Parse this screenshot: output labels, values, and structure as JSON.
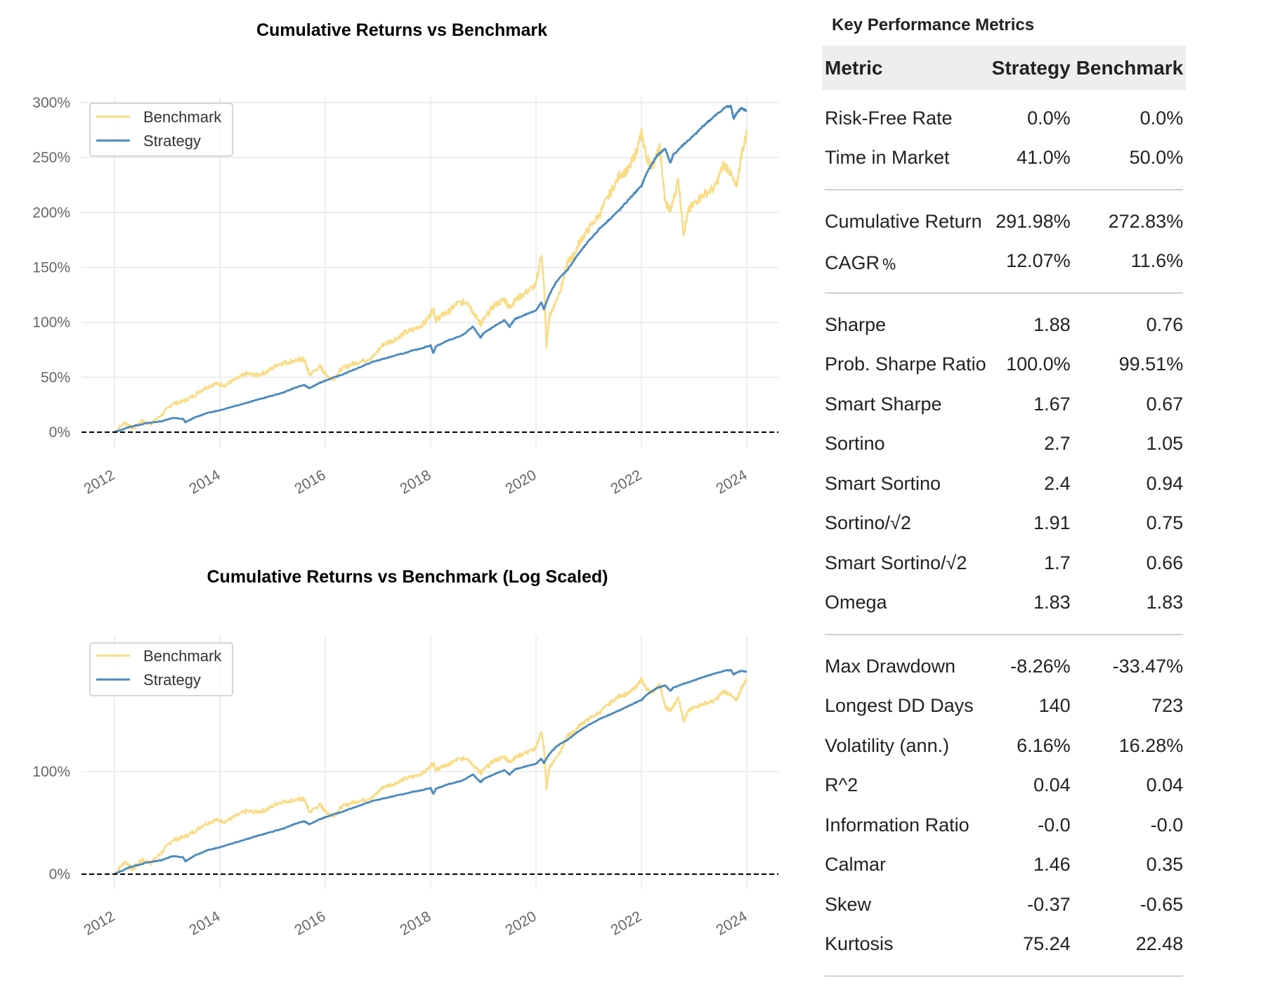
{
  "colors": {
    "benchmark": "#f9dc86",
    "strategy": "#4a89bf",
    "grid": "#e5e5e5",
    "zero_line": "#000000",
    "header_bg": "#eeeeee"
  },
  "chart_data": [
    {
      "type": "line",
      "title": "Cumulative Returns vs Benchmark",
      "xlabel": "",
      "ylabel": "",
      "yscale": "linear",
      "xlim": [
        2011.6,
        2024.6
      ],
      "ylim": [
        -0.1,
        3.0
      ],
      "x_ticks": [
        "2012",
        "2014",
        "2016",
        "2018",
        "2020",
        "2022",
        "2024"
      ],
      "x_tick_values": [
        2012,
        2014,
        2016,
        2018,
        2020,
        2022,
        2024
      ],
      "y_ticks": [
        "0%",
        "50%",
        "100%",
        "150%",
        "200%",
        "250%",
        "300%"
      ],
      "y_tick_values": [
        0,
        0.5,
        1.0,
        1.5,
        2.0,
        2.5,
        3.0
      ],
      "grid": true,
      "legend": "top-left",
      "reference_line": {
        "y": 0,
        "style": "dashed"
      },
      "series": [
        {
          "name": "Benchmark",
          "x": [
            2012.0,
            2012.2,
            2012.35,
            2012.5,
            2012.7,
            2012.9,
            2013.1,
            2013.3,
            2013.5,
            2013.7,
            2013.9,
            2014.1,
            2014.3,
            2014.5,
            2014.7,
            2014.9,
            2015.1,
            2015.3,
            2015.5,
            2015.6,
            2015.7,
            2015.9,
            2016.0,
            2016.15,
            2016.3,
            2016.5,
            2016.7,
            2016.9,
            2017.1,
            2017.3,
            2017.5,
            2017.7,
            2017.9,
            2018.05,
            2018.1,
            2018.2,
            2018.35,
            2018.5,
            2018.7,
            2018.8,
            2018.95,
            2019.0,
            2019.2,
            2019.4,
            2019.5,
            2019.6,
            2019.8,
            2020.0,
            2020.1,
            2020.15,
            2020.2,
            2020.25,
            2020.35,
            2020.5,
            2020.6,
            2020.7,
            2020.85,
            2021.0,
            2021.2,
            2021.4,
            2021.6,
            2021.75,
            2021.9,
            2022.0,
            2022.1,
            2022.2,
            2022.35,
            2022.45,
            2022.55,
            2022.7,
            2022.8,
            2022.9,
            2023.05,
            2023.2,
            2023.4,
            2023.55,
            2023.65,
            2023.8,
            2023.9,
            2024.0
          ],
          "y": [
            0.0,
            0.09,
            0.03,
            0.1,
            0.08,
            0.16,
            0.26,
            0.28,
            0.33,
            0.4,
            0.44,
            0.43,
            0.48,
            0.53,
            0.52,
            0.55,
            0.62,
            0.64,
            0.66,
            0.66,
            0.52,
            0.6,
            0.53,
            0.48,
            0.57,
            0.62,
            0.65,
            0.68,
            0.8,
            0.84,
            0.9,
            0.94,
            1.0,
            1.12,
            1.02,
            1.06,
            1.1,
            1.17,
            1.19,
            1.1,
            0.98,
            1.02,
            1.15,
            1.21,
            1.13,
            1.2,
            1.27,
            1.34,
            1.63,
            1.35,
            0.77,
            1.05,
            1.16,
            1.35,
            1.55,
            1.6,
            1.75,
            1.85,
            1.98,
            2.17,
            2.35,
            2.38,
            2.55,
            2.72,
            2.5,
            2.42,
            2.58,
            2.1,
            2.01,
            2.3,
            1.82,
            2.02,
            2.11,
            2.17,
            2.23,
            2.43,
            2.4,
            2.22,
            2.53,
            2.72
          ]
        },
        {
          "name": "Strategy",
          "x": [
            2012.0,
            2012.3,
            2012.6,
            2012.9,
            2013.1,
            2013.3,
            2013.35,
            2013.5,
            2013.8,
            2014.0,
            2014.3,
            2014.6,
            2014.9,
            2015.2,
            2015.4,
            2015.6,
            2015.7,
            2015.9,
            2016.0,
            2016.3,
            2016.6,
            2016.9,
            2017.2,
            2017.5,
            2017.8,
            2018.0,
            2018.05,
            2018.1,
            2018.3,
            2018.6,
            2018.8,
            2018.95,
            2019.0,
            2019.2,
            2019.4,
            2019.5,
            2019.6,
            2019.8,
            2020.0,
            2020.1,
            2020.15,
            2020.25,
            2020.4,
            2020.6,
            2020.8,
            2021.0,
            2021.2,
            2021.4,
            2021.6,
            2021.8,
            2022.0,
            2022.1,
            2022.3,
            2022.45,
            2022.55,
            2022.6,
            2022.8,
            2023.0,
            2023.2,
            2023.4,
            2023.6,
            2023.7,
            2023.75,
            2023.8,
            2023.9,
            2024.0
          ],
          "y": [
            0.0,
            0.05,
            0.08,
            0.1,
            0.13,
            0.12,
            0.09,
            0.13,
            0.18,
            0.2,
            0.24,
            0.28,
            0.32,
            0.36,
            0.4,
            0.43,
            0.4,
            0.45,
            0.47,
            0.52,
            0.58,
            0.64,
            0.68,
            0.72,
            0.76,
            0.79,
            0.72,
            0.78,
            0.83,
            0.88,
            0.96,
            0.86,
            0.9,
            0.96,
            1.02,
            0.96,
            1.03,
            1.07,
            1.11,
            1.18,
            1.12,
            1.25,
            1.38,
            1.48,
            1.62,
            1.74,
            1.85,
            1.94,
            2.03,
            2.14,
            2.24,
            2.36,
            2.52,
            2.58,
            2.45,
            2.52,
            2.62,
            2.7,
            2.8,
            2.88,
            2.96,
            2.97,
            2.85,
            2.9,
            2.95,
            2.92
          ]
        }
      ]
    },
    {
      "type": "line",
      "title": "Cumulative Returns vs Benchmark (Log Scaled)",
      "xlabel": "",
      "ylabel": "",
      "yscale": "log(1+r)",
      "xlim": [
        2011.6,
        2024.6
      ],
      "x_ticks": [
        "2012",
        "2014",
        "2016",
        "2018",
        "2020",
        "2022",
        "2024"
      ],
      "x_tick_values": [
        2012,
        2014,
        2016,
        2018,
        2020,
        2022,
        2024
      ],
      "y_ticks": [
        "0%",
        "100%"
      ],
      "y_tick_values": [
        0,
        1.0
      ],
      "grid": true,
      "legend": "top-left",
      "reference_line": {
        "y": 0,
        "style": "dashed"
      },
      "series_ref": "same data as chart 1, plotted on log(1 + return) scale"
    }
  ],
  "legend": {
    "items": [
      {
        "label": "Benchmark",
        "series": "benchmark"
      },
      {
        "label": "Strategy",
        "series": "strategy"
      }
    ]
  },
  "metrics": {
    "title": "Key Performance Metrics",
    "headers": {
      "metric": "Metric",
      "strategy": "Strategy",
      "benchmark": "Benchmark"
    },
    "groups": [
      [
        {
          "metric": "Risk-Free Rate",
          "strategy": "0.0%",
          "benchmark": "0.0%"
        },
        {
          "metric": "Time in Market",
          "strategy": "41.0%",
          "benchmark": "50.0%"
        }
      ],
      [
        {
          "metric": "Cumulative Return",
          "strategy": "291.98%",
          "benchmark": "272.83%"
        },
        {
          "metric": "CAGR﹪",
          "strategy": "12.07%",
          "benchmark": "11.6%"
        }
      ],
      [
        {
          "metric": "Sharpe",
          "strategy": "1.88",
          "benchmark": "0.76"
        },
        {
          "metric": "Prob. Sharpe Ratio",
          "strategy": "100.0%",
          "benchmark": "99.51%"
        },
        {
          "metric": "Smart Sharpe",
          "strategy": "1.67",
          "benchmark": "0.67"
        },
        {
          "metric": "Sortino",
          "strategy": "2.7",
          "benchmark": "1.05"
        },
        {
          "metric": "Smart Sortino",
          "strategy": "2.4",
          "benchmark": "0.94"
        },
        {
          "metric": "Sortino/√2",
          "strategy": "1.91",
          "benchmark": "0.75"
        },
        {
          "metric": "Smart Sortino/√2",
          "strategy": "1.7",
          "benchmark": "0.66"
        },
        {
          "metric": "Omega",
          "strategy": "1.83",
          "benchmark": "1.83"
        }
      ],
      [
        {
          "metric": "Max Drawdown",
          "strategy": "-8.26%",
          "benchmark": "-33.47%"
        },
        {
          "metric": "Longest DD Days",
          "strategy": "140",
          "benchmark": "723"
        },
        {
          "metric": "Volatility (ann.)",
          "strategy": "6.16%",
          "benchmark": "16.28%"
        },
        {
          "metric": "R^2",
          "strategy": "0.04",
          "benchmark": "0.04"
        },
        {
          "metric": "Information Ratio",
          "strategy": "-0.0",
          "benchmark": "-0.0"
        },
        {
          "metric": "Calmar",
          "strategy": "1.46",
          "benchmark": "0.35"
        },
        {
          "metric": "Skew",
          "strategy": "-0.37",
          "benchmark": "-0.65"
        },
        {
          "metric": "Kurtosis",
          "strategy": "75.24",
          "benchmark": "22.48"
        }
      ]
    ]
  }
}
